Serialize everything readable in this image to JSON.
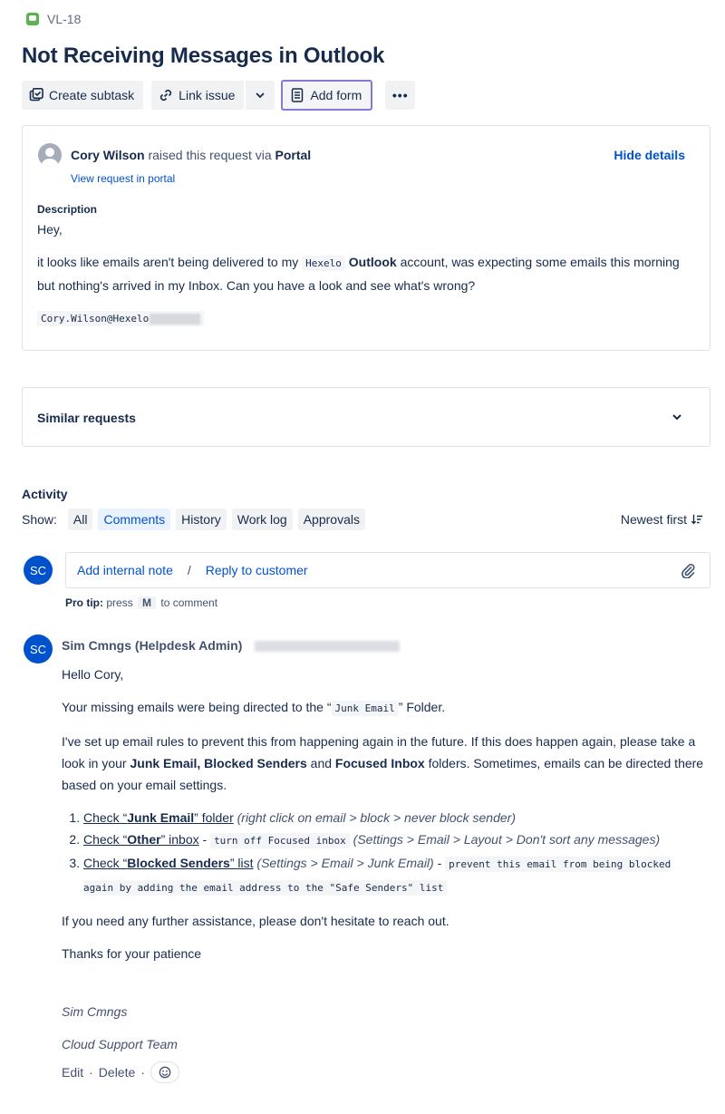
{
  "issue": {
    "key": "VL-18",
    "title": "Not Receiving Messages in Outlook"
  },
  "toolbar": {
    "create_subtask": "Create subtask",
    "link_issue": "Link issue",
    "add_form": "Add form",
    "more": "•••"
  },
  "request": {
    "reporter": "Cory Wilson",
    "raised_text": "raised this request via",
    "channel": "Portal",
    "view_portal": "View request in portal",
    "hide_details": "Hide details",
    "description_label": "Description",
    "greeting": "Hey,",
    "body_before": "it looks like emails aren't being delivered to my",
    "body_code": "Hexelo",
    "body_bold": "Outlook",
    "body_after": "account, was expecting some emails this morning but nothing's arrived in my Inbox. Can you have a look and see what's wrong?",
    "email_code": "Cory.Wilson@Hexelo"
  },
  "similar": {
    "label": "Similar requests"
  },
  "activity": {
    "title": "Activity",
    "show_label": "Show:",
    "filters": [
      "All",
      "Comments",
      "History",
      "Work log",
      "Approvals"
    ],
    "active_filter": "Comments",
    "sort": "Newest first"
  },
  "composer": {
    "avatar": "SC",
    "internal_note": "Add internal note",
    "separator": "/",
    "reply": "Reply to customer",
    "protip_label": "Pro tip:",
    "protip_press": "press",
    "protip_key": "M",
    "protip_after": "to comment"
  },
  "comment": {
    "avatar": "SC",
    "author": "Sim Cmngs (Helpdesk Admin)",
    "greeting": "Hello Cory,",
    "p1_before": "Your missing emails were being directed to the “",
    "p1_code": "Junk Email",
    "p1_after": "” Folder.",
    "p2_a": "I've set up email rules to prevent this from happening again in the future. If this does happen again, please take a look in your",
    "p2_b1": "Junk Email, Blocked Senders",
    "p2_and": "and",
    "p2_b2": "Focused Inbox",
    "p2_c": "folders. Sometimes, emails can be directed there based on your email settings.",
    "steps": [
      {
        "pre": "Check “",
        "bold": "Junk Email",
        "post": "” folder",
        "italic": "(right click on email > block > never block sender)",
        "dash": "",
        "code": "",
        "italic2": ""
      },
      {
        "pre": "Check “",
        "bold": "Other",
        "post": "” inbox",
        "italic": "",
        "dash": " - ",
        "code": "turn off Focused inbox",
        "italic2": "(Settings > Email > Layout > Don't sort any messages)"
      },
      {
        "pre": "Check “",
        "bold": "Blocked Senders",
        "post": "” list",
        "italic": "(Settings > Email > Junk Email)",
        "dash": " - ",
        "code": "prevent this email from being blocked again by adding the email address to the \"Safe Senders\" list",
        "italic2": ""
      }
    ],
    "p3": "If you need any further assistance, please don't hesitate to reach out.",
    "p4": "Thanks for your patience",
    "sig_name": "Sim Cmngs",
    "sig_team": "Cloud Support Team",
    "edit": "Edit",
    "delete": "Delete",
    "dot": "·"
  }
}
